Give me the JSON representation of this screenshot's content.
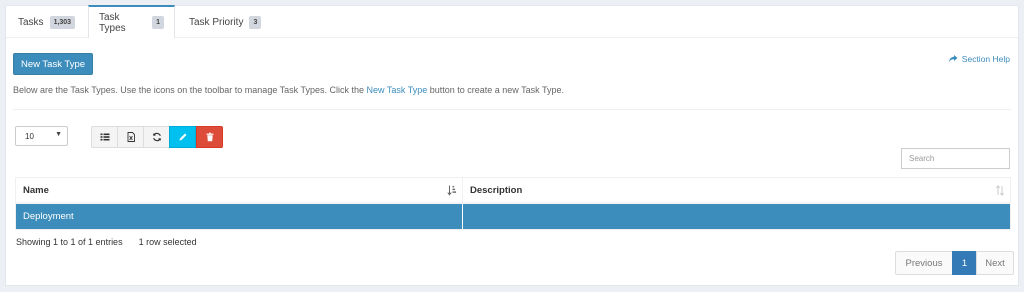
{
  "tabs": [
    {
      "label": "Tasks",
      "badge": "1,303"
    },
    {
      "label": "Task Types",
      "badge": "1"
    },
    {
      "label": "Task Priority",
      "badge": "3"
    }
  ],
  "toolbar": {
    "new_button": "New Task Type",
    "section_help": "Section Help"
  },
  "intro": {
    "before": "Below are the Task Types. Use the icons on the toolbar to manage Task Types. Click the ",
    "link": "New Task Type",
    "after": " button to create a new Task Type."
  },
  "table_controls": {
    "page_length": "10",
    "search_placeholder": "Search",
    "icons": [
      "list-icon",
      "excel-icon",
      "refresh-icon",
      "edit-icon",
      "trash-icon"
    ],
    "accent_edit": "#00c0ef",
    "accent_delete": "#dd4b39"
  },
  "table": {
    "columns": [
      "Name",
      "Description"
    ],
    "rows": [
      {
        "name": "Deployment",
        "description": "",
        "selected": true
      }
    ]
  },
  "footer": {
    "entries_info": "Showing 1 to 1 of 1 entries",
    "selection_info": "1 row selected",
    "pagination": {
      "previous": "Previous",
      "current": "1",
      "next": "Next"
    }
  },
  "colors": {
    "primary": "#3c8dbc",
    "page_bg": "#ecf0f5"
  }
}
